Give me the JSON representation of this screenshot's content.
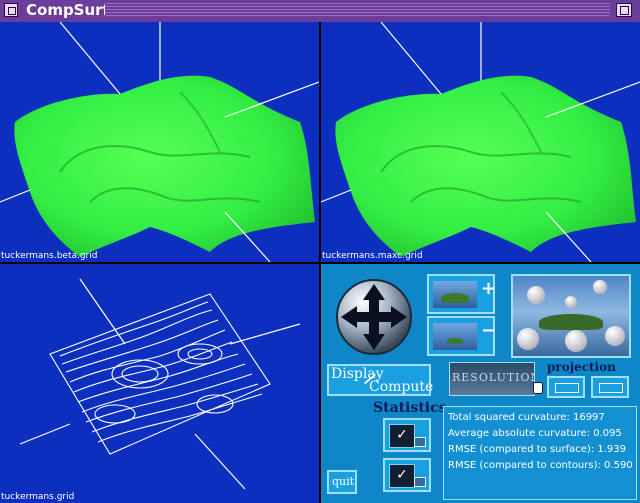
{
  "window": {
    "title": "CompSurf"
  },
  "views": [
    {
      "label": "tuckermans.beta.grid"
    },
    {
      "label": "tuckermans.maxc.grid"
    },
    {
      "label": "tuckermans.grid"
    }
  ],
  "controls": {
    "zoom_in_symbol": "+",
    "zoom_out_symbol": "−",
    "display_label": "Display",
    "compute_label": "Compute",
    "resolution_label": "RESOLUTION",
    "projection_type_label": "projection type",
    "statistics_label": "Statistics",
    "quit_label": "quit",
    "check_mark": "✓"
  },
  "statistics": [
    "Total squared curvature: 16997",
    "Average absolute curvature: 0.095",
    "RMSE (compared to surface): 1.939",
    "RMSE (compared to contours): 0.590"
  ],
  "colors": {
    "viewport_bg": "#0d2fbf",
    "surface": "#33ee44",
    "panel": "#0f86c8",
    "titlebar": "#6a3d9a"
  }
}
